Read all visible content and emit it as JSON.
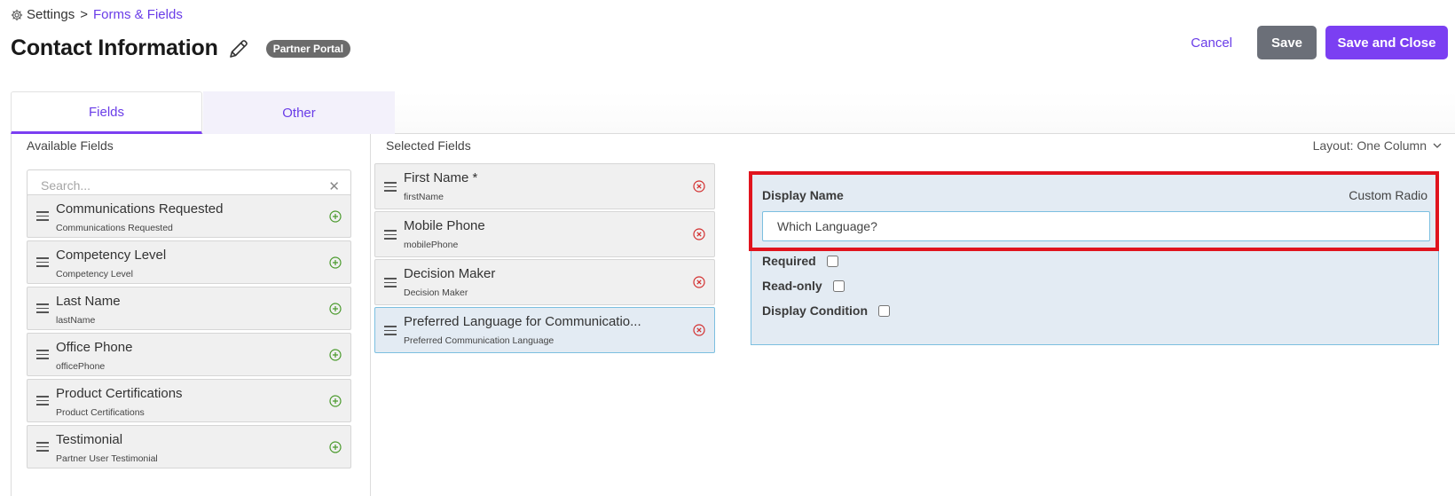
{
  "breadcrumb": {
    "root": "Settings",
    "separator": ">",
    "current": "Forms & Fields"
  },
  "page": {
    "title": "Contact Information",
    "badge": "Partner Portal"
  },
  "actions": {
    "cancel": "Cancel",
    "save": "Save",
    "save_close": "Save and Close"
  },
  "tabs": [
    {
      "label": "Fields",
      "active": true
    },
    {
      "label": "Other",
      "active": false
    }
  ],
  "available": {
    "heading": "Available Fields",
    "search_placeholder": "Search...",
    "items": [
      {
        "name": "Communications Requested",
        "key": "Communications Requested"
      },
      {
        "name": "Competency Level",
        "key": "Competency Level"
      },
      {
        "name": "Last Name",
        "key": "lastName"
      },
      {
        "name": "Office Phone",
        "key": "officePhone"
      },
      {
        "name": "Product Certifications",
        "key": "Product Certifications"
      },
      {
        "name": "Testimonial",
        "key": "Partner User Testimonial"
      }
    ]
  },
  "selected": {
    "heading": "Selected Fields",
    "layout": "Layout: One Column",
    "items": [
      {
        "name": "First Name *",
        "key": "firstName"
      },
      {
        "name": "Mobile Phone",
        "key": "mobilePhone"
      },
      {
        "name": "Decision Maker",
        "key": "Decision Maker"
      },
      {
        "name": "Preferred Language for Communicatio...",
        "key": "Preferred Communication Language",
        "active": true
      }
    ]
  },
  "detail": {
    "display_name_label": "Display Name",
    "field_type": "Custom Radio",
    "display_name_value": "Which Language?",
    "required_label": "Required",
    "readonly_label": "Read-only",
    "condition_label": "Display Condition"
  },
  "colors": {
    "accent": "#7b3ff2",
    "link": "#6a3de8",
    "highlight": "#e0141e",
    "selected_bg": "#e3ebf3"
  }
}
